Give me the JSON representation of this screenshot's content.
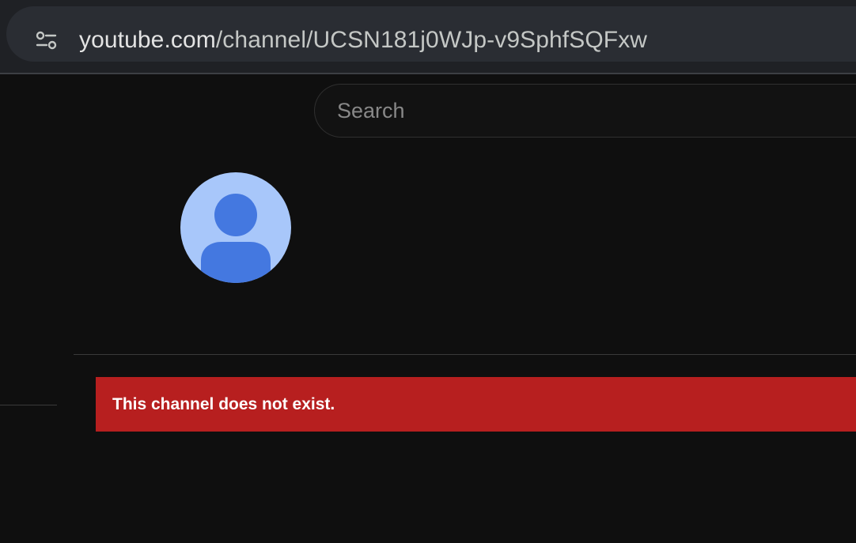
{
  "browser": {
    "url_host": "youtube.com",
    "url_path": "/channel/UCSN181j0WJp-v9SphfSQFxw",
    "site_info_icon": "tune-icon"
  },
  "search": {
    "placeholder": "Search",
    "value": ""
  },
  "channel": {
    "avatar_icon": "default-person-avatar"
  },
  "error": {
    "message": "This channel does not exist."
  },
  "colors": {
    "page_background": "#0f0f0f",
    "error_background": "#b71f1f",
    "avatar_background": "#a8c7fa",
    "avatar_figure": "#4478e0"
  }
}
